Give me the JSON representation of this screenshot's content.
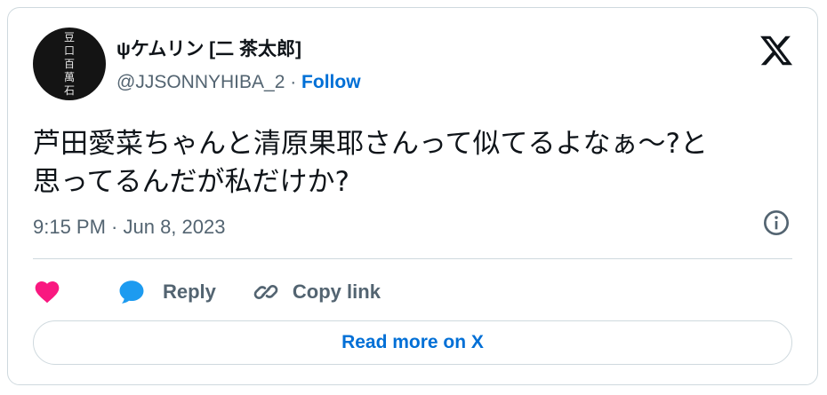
{
  "author": {
    "display_name": "ψケムリン [二 茶太郎]",
    "handle": "@JJSONNYHIBA_2",
    "separator": " · ",
    "follow_label": "Follow",
    "avatar_text": [
      "豆",
      "口",
      "百",
      "萬",
      "石"
    ]
  },
  "tweet": {
    "text_line1": "芦田愛菜ちゃんと清原果耶さんって似てるよなぁ〜?と",
    "text_line2": "思ってるんだが私だけか?",
    "timestamp": "9:15 PM · Jun 8, 2023"
  },
  "actions": {
    "like_icon": "heart-icon",
    "reply_icon": "speech-bubble-icon",
    "reply_label": "Reply",
    "copy_icon": "link-icon",
    "copy_label": "Copy link"
  },
  "read_more_label": "Read more on X",
  "colors": {
    "text": "#0f1419",
    "muted": "#536471",
    "link": "#006fd6",
    "like": "#f91880",
    "reply": "#1d9bf0",
    "border": "#cfd9de"
  }
}
